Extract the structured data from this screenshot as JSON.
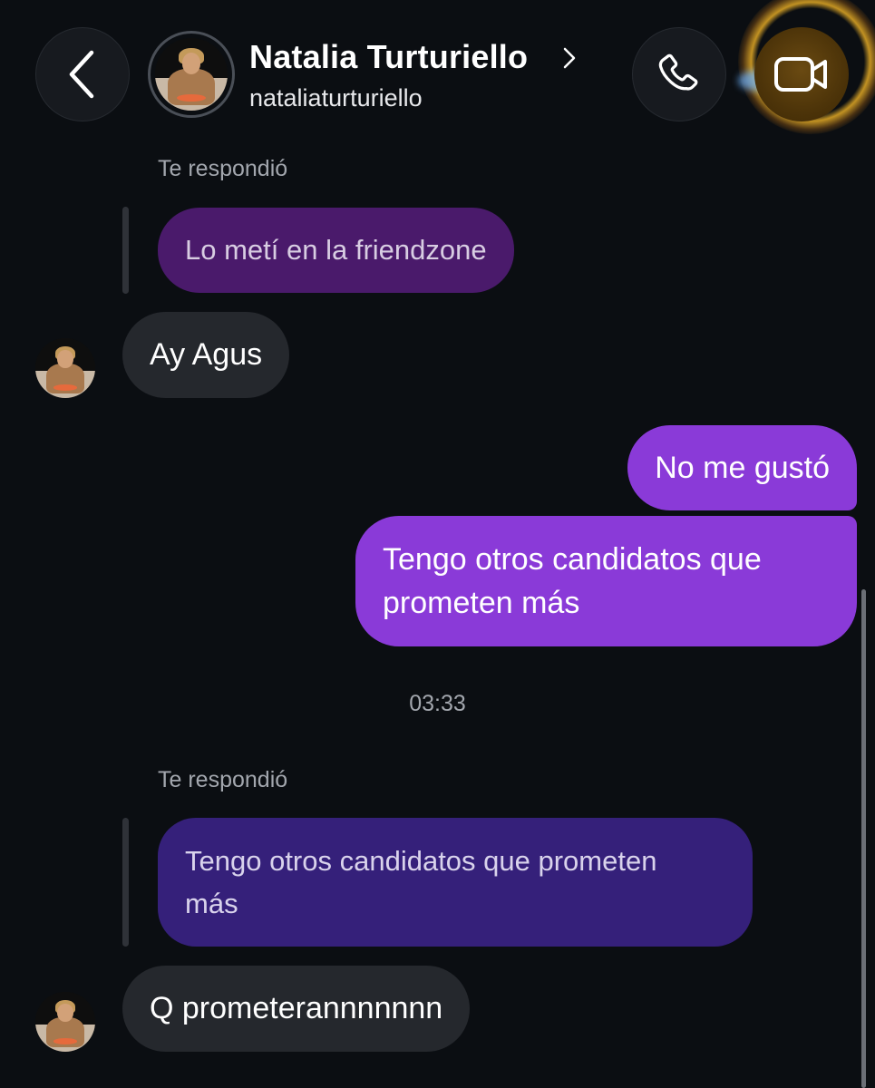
{
  "header": {
    "contact_name": "Natalia Turturiello",
    "handle": "nataliaturturiello",
    "icons": {
      "back": "chevron-left-icon",
      "details": "chevron-right-icon",
      "call": "phone-icon",
      "video": "video-camera-icon"
    },
    "video_accent": "#ffbe28"
  },
  "messages": [
    {
      "type": "reply_context",
      "label": "Te respondió",
      "quoted_text": "Lo metí en la friendzone"
    },
    {
      "type": "incoming",
      "text": "Ay Agus"
    },
    {
      "type": "outgoing",
      "text": "No me gustó"
    },
    {
      "type": "outgoing",
      "lines": [
        "Tengo otros candidatos que",
        "prometen más"
      ]
    },
    {
      "type": "timestamp",
      "text": "03:33"
    },
    {
      "type": "reply_context",
      "label": "Te respondió",
      "quoted_lines": [
        "Tengo otros candidatos que prometen",
        "más"
      ]
    },
    {
      "type": "incoming",
      "text": "Q prometerannnnnnn"
    }
  ],
  "colors": {
    "background": "#0b0e12",
    "outgoing_bubble": "#8a3ad8",
    "incoming_bubble": "#25282d",
    "quoted_bubble_1": "#4a1a6b",
    "quoted_bubble_2": "#35207a"
  }
}
